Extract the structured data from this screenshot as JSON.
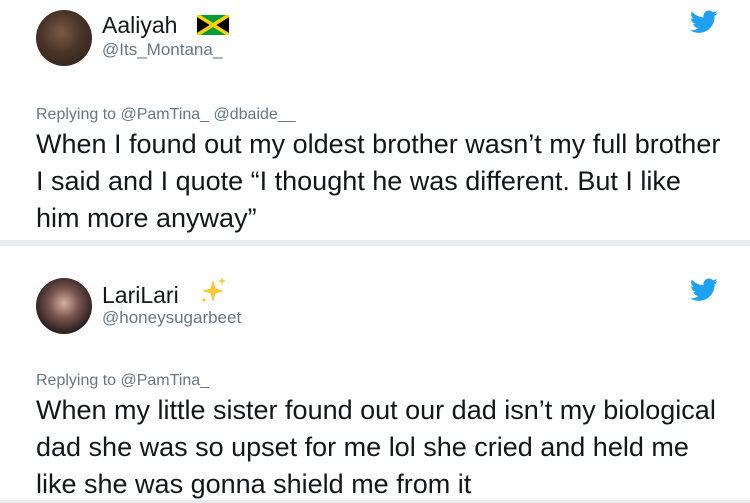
{
  "tweets": [
    {
      "display_name": "Aaliyah",
      "handle": "@Its_Montana_",
      "replying_to": "Replying to @PamTina_ @dbaide__",
      "text": "When I found out my oldest brother wasn’t my full brother I said and I quote “I thought he was different. But I like him more anyway”",
      "name_emoji": "jamaica-flag-icon"
    },
    {
      "display_name": "LariLari",
      "handle": "@honeysugarbeet",
      "replying_to": "Replying to @PamTina_",
      "text": "When my little sister found out our dad isn’t my biological dad she was so upset for me lol she cried and held me like she was gonna shield me from it",
      "name_emoji": "sparkles-icon"
    }
  ],
  "colors": {
    "twitter_blue": "#1da1f2",
    "text_primary": "#14171a",
    "text_secondary": "#657786",
    "card_background": "#ffffff",
    "page_background": "#e9ebee"
  }
}
